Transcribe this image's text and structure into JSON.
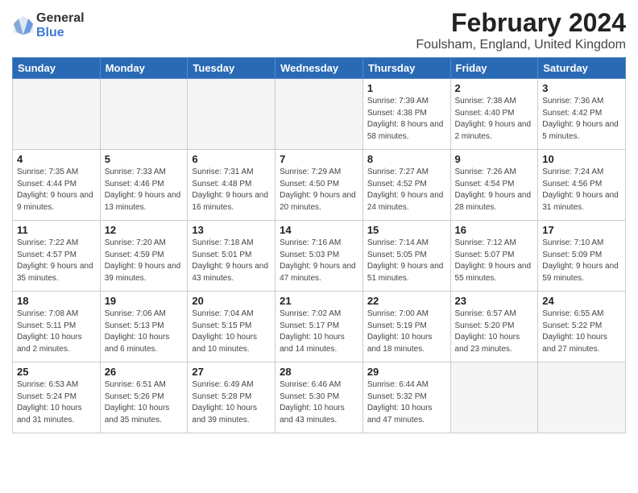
{
  "header": {
    "logo_general": "General",
    "logo_blue": "Blue",
    "title": "February 2024",
    "subtitle": "Foulsham, England, United Kingdom"
  },
  "days_of_week": [
    "Sunday",
    "Monday",
    "Tuesday",
    "Wednesday",
    "Thursday",
    "Friday",
    "Saturday"
  ],
  "weeks": [
    [
      {
        "day": "",
        "detail": ""
      },
      {
        "day": "",
        "detail": ""
      },
      {
        "day": "",
        "detail": ""
      },
      {
        "day": "",
        "detail": ""
      },
      {
        "day": "1",
        "detail": "Sunrise: 7:39 AM\nSunset: 4:38 PM\nDaylight: 8 hours\nand 58 minutes."
      },
      {
        "day": "2",
        "detail": "Sunrise: 7:38 AM\nSunset: 4:40 PM\nDaylight: 9 hours\nand 2 minutes."
      },
      {
        "day": "3",
        "detail": "Sunrise: 7:36 AM\nSunset: 4:42 PM\nDaylight: 9 hours\nand 5 minutes."
      }
    ],
    [
      {
        "day": "4",
        "detail": "Sunrise: 7:35 AM\nSunset: 4:44 PM\nDaylight: 9 hours\nand 9 minutes."
      },
      {
        "day": "5",
        "detail": "Sunrise: 7:33 AM\nSunset: 4:46 PM\nDaylight: 9 hours\nand 13 minutes."
      },
      {
        "day": "6",
        "detail": "Sunrise: 7:31 AM\nSunset: 4:48 PM\nDaylight: 9 hours\nand 16 minutes."
      },
      {
        "day": "7",
        "detail": "Sunrise: 7:29 AM\nSunset: 4:50 PM\nDaylight: 9 hours\nand 20 minutes."
      },
      {
        "day": "8",
        "detail": "Sunrise: 7:27 AM\nSunset: 4:52 PM\nDaylight: 9 hours\nand 24 minutes."
      },
      {
        "day": "9",
        "detail": "Sunrise: 7:26 AM\nSunset: 4:54 PM\nDaylight: 9 hours\nand 28 minutes."
      },
      {
        "day": "10",
        "detail": "Sunrise: 7:24 AM\nSunset: 4:56 PM\nDaylight: 9 hours\nand 31 minutes."
      }
    ],
    [
      {
        "day": "11",
        "detail": "Sunrise: 7:22 AM\nSunset: 4:57 PM\nDaylight: 9 hours\nand 35 minutes."
      },
      {
        "day": "12",
        "detail": "Sunrise: 7:20 AM\nSunset: 4:59 PM\nDaylight: 9 hours\nand 39 minutes."
      },
      {
        "day": "13",
        "detail": "Sunrise: 7:18 AM\nSunset: 5:01 PM\nDaylight: 9 hours\nand 43 minutes."
      },
      {
        "day": "14",
        "detail": "Sunrise: 7:16 AM\nSunset: 5:03 PM\nDaylight: 9 hours\nand 47 minutes."
      },
      {
        "day": "15",
        "detail": "Sunrise: 7:14 AM\nSunset: 5:05 PM\nDaylight: 9 hours\nand 51 minutes."
      },
      {
        "day": "16",
        "detail": "Sunrise: 7:12 AM\nSunset: 5:07 PM\nDaylight: 9 hours\nand 55 minutes."
      },
      {
        "day": "17",
        "detail": "Sunrise: 7:10 AM\nSunset: 5:09 PM\nDaylight: 9 hours\nand 59 minutes."
      }
    ],
    [
      {
        "day": "18",
        "detail": "Sunrise: 7:08 AM\nSunset: 5:11 PM\nDaylight: 10 hours\nand 2 minutes."
      },
      {
        "day": "19",
        "detail": "Sunrise: 7:06 AM\nSunset: 5:13 PM\nDaylight: 10 hours\nand 6 minutes."
      },
      {
        "day": "20",
        "detail": "Sunrise: 7:04 AM\nSunset: 5:15 PM\nDaylight: 10 hours\nand 10 minutes."
      },
      {
        "day": "21",
        "detail": "Sunrise: 7:02 AM\nSunset: 5:17 PM\nDaylight: 10 hours\nand 14 minutes."
      },
      {
        "day": "22",
        "detail": "Sunrise: 7:00 AM\nSunset: 5:19 PM\nDaylight: 10 hours\nand 18 minutes."
      },
      {
        "day": "23",
        "detail": "Sunrise: 6:57 AM\nSunset: 5:20 PM\nDaylight: 10 hours\nand 23 minutes."
      },
      {
        "day": "24",
        "detail": "Sunrise: 6:55 AM\nSunset: 5:22 PM\nDaylight: 10 hours\nand 27 minutes."
      }
    ],
    [
      {
        "day": "25",
        "detail": "Sunrise: 6:53 AM\nSunset: 5:24 PM\nDaylight: 10 hours\nand 31 minutes."
      },
      {
        "day": "26",
        "detail": "Sunrise: 6:51 AM\nSunset: 5:26 PM\nDaylight: 10 hours\nand 35 minutes."
      },
      {
        "day": "27",
        "detail": "Sunrise: 6:49 AM\nSunset: 5:28 PM\nDaylight: 10 hours\nand 39 minutes."
      },
      {
        "day": "28",
        "detail": "Sunrise: 6:46 AM\nSunset: 5:30 PM\nDaylight: 10 hours\nand 43 minutes."
      },
      {
        "day": "29",
        "detail": "Sunrise: 6:44 AM\nSunset: 5:32 PM\nDaylight: 10 hours\nand 47 minutes."
      },
      {
        "day": "",
        "detail": ""
      },
      {
        "day": "",
        "detail": ""
      }
    ]
  ]
}
